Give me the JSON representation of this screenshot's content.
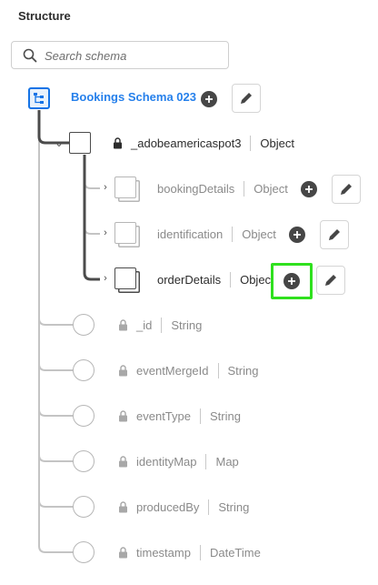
{
  "panel": {
    "title": "Structure"
  },
  "search": {
    "placeholder": "Search schema"
  },
  "root": {
    "label": "Bookings Schema 023"
  },
  "tenant": {
    "name": "_adobeamericaspot3",
    "type": "Object"
  },
  "subfields": [
    {
      "name": "bookingDetails",
      "type": "Object"
    },
    {
      "name": "identification",
      "type": "Object"
    },
    {
      "name": "orderDetails",
      "type": "Objec"
    }
  ],
  "fields": [
    {
      "name": "_id",
      "type": "String"
    },
    {
      "name": "eventMergeId",
      "type": "String"
    },
    {
      "name": "eventType",
      "type": "String"
    },
    {
      "name": "identityMap",
      "type": "Map"
    },
    {
      "name": "producedBy",
      "type": "String"
    },
    {
      "name": "timestamp",
      "type": "DateTime"
    }
  ],
  "colors": {
    "accent": "#2680eb",
    "highlight": "#2fe01e",
    "tree_line_dark": "#4b4b4b",
    "tree_line_light": "#c4c4c4"
  }
}
